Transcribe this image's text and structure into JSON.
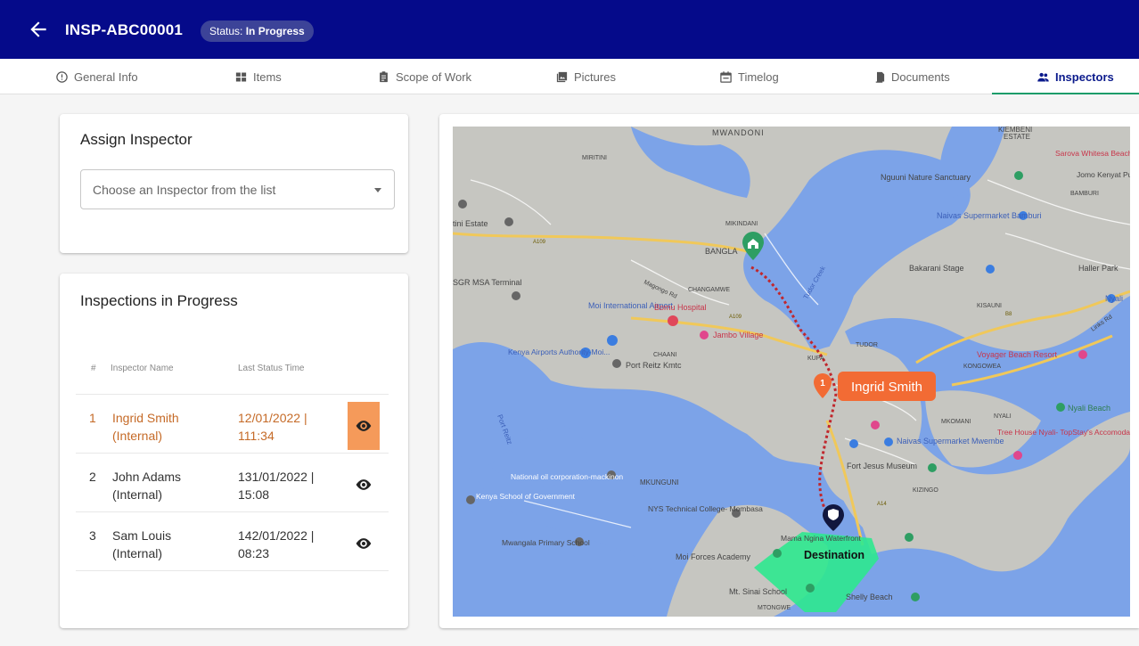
{
  "header": {
    "title": "INSP-ABC00001",
    "status_prefix": "Status:",
    "status_value": "In Progress"
  },
  "tabs": [
    {
      "label": "General Info",
      "icon": "info-circle-icon"
    },
    {
      "label": "Items",
      "icon": "grid-icon"
    },
    {
      "label": "Scope of Work",
      "icon": "clipboard-icon"
    },
    {
      "label": "Pictures",
      "icon": "photo-library-icon"
    },
    {
      "label": "Timelog",
      "icon": "calendar-icon"
    },
    {
      "label": "Documents",
      "icon": "documents-icon"
    },
    {
      "label": "Inspectors",
      "icon": "people-icon",
      "active": true
    }
  ],
  "assign": {
    "title": "Assign Inspector",
    "select_placeholder": "Choose an Inspector from the list"
  },
  "inspections": {
    "title": "Inspections in Progress",
    "columns": {
      "num": "#",
      "name": "Inspector Name",
      "time": "Last Status Time"
    },
    "rows": [
      {
        "num": "1",
        "name": "Ingrid Smith (Internal)",
        "time": "12/01/2022 | 111:34",
        "highlighted": true
      },
      {
        "num": "2",
        "name": "John Adams (Internal)",
        "time": "131/01/2022 | 15:08",
        "highlighted": false
      },
      {
        "num": "3",
        "name": "Sam Louis (Internal)",
        "time": "142/01/2022 | 08:23",
        "highlighted": false
      }
    ]
  },
  "map": {
    "labels": {
      "mwandoni": "MWANDONI",
      "kiembeni": "KIEMBENI",
      "estate": "ESTATE",
      "miritini": "MIRITINI",
      "mikindani": "MIKINDANI",
      "bangla": "BANGLA",
      "estate_left": "tini Estate",
      "sgr": "SGR MSA Terminal",
      "moi_airport": "Moi International Airport",
      "bomu": "Bomu Hospital",
      "jambo": "Jambo Village",
      "changamwe": "CHANGAMWE",
      "kenya_airports": "Kenya Airports Authority-Moi...",
      "port_reitz_kmtc": "Port Reitz Kmtc",
      "chaani": "CHAANI",
      "port_reitz": "Port Reitz",
      "national_oil": "National oil corporation-mackinon",
      "mkunguni": "MKUNGUNI",
      "kenya_school": "Kenya School of Government",
      "nys": "NYS Technical College- Mombasa",
      "mwangala": "Mwangala Primary School",
      "moi_forces": "Moi Forces Academy",
      "mt_sinai": "Mt. Sinai School",
      "mtongwe": "MTONGWE",
      "shelly": "Shelly Beach",
      "mama_ngina": "Mama Ngina Waterfront",
      "fort_jesus": "Fort Jesus Museum",
      "kizingo": "KIZINGO",
      "naivas_mwembe": "Naivas Supermarket Mwembe",
      "tudor": "TUDOR",
      "kisauni": "KISAUNI",
      "kongowea": "KONGOWEA",
      "mkomani": "MKOMANI",
      "nyali": "NYALI",
      "voyager": "Voyager Beach Resort",
      "nyali_beach": "Nyali Beach",
      "tree_house": "Tree House Nyali- TopStay's Accomodation",
      "nguuni": "Nguuni Nature Sanctuary",
      "naivas_bamburi": "Naivas Supermarket Bamburi",
      "bakarani": "Bakarani Stage",
      "haller": "Haller Park",
      "sarova": "Sarova Whitesa Beach Resort & S",
      "jomo": "Jomo Kenyat Public Beac",
      "bamburi": "BAMBURI",
      "nyali_right": "Nyali",
      "tudor_creek": "Tudor Creek",
      "magongo": "Magongo Rd",
      "links_rd": "Links Rd",
      "kupa": "KUPA",
      "a109": "A109",
      "b8": "B8",
      "a14": "A14",
      "ingrid_marker": "Ingrid Smith",
      "ingrid_marker_num": "1",
      "destination": "Destination"
    },
    "colors": {
      "water": "#7ca3e8",
      "land": "#c6c6c1",
      "road_major": "#f0c85a",
      "route": "#c0272d",
      "zone": "#2ee88f",
      "marker_orange": "#f26b34",
      "marker_green": "#2e9e63",
      "marker_navy": "#11173f"
    }
  }
}
